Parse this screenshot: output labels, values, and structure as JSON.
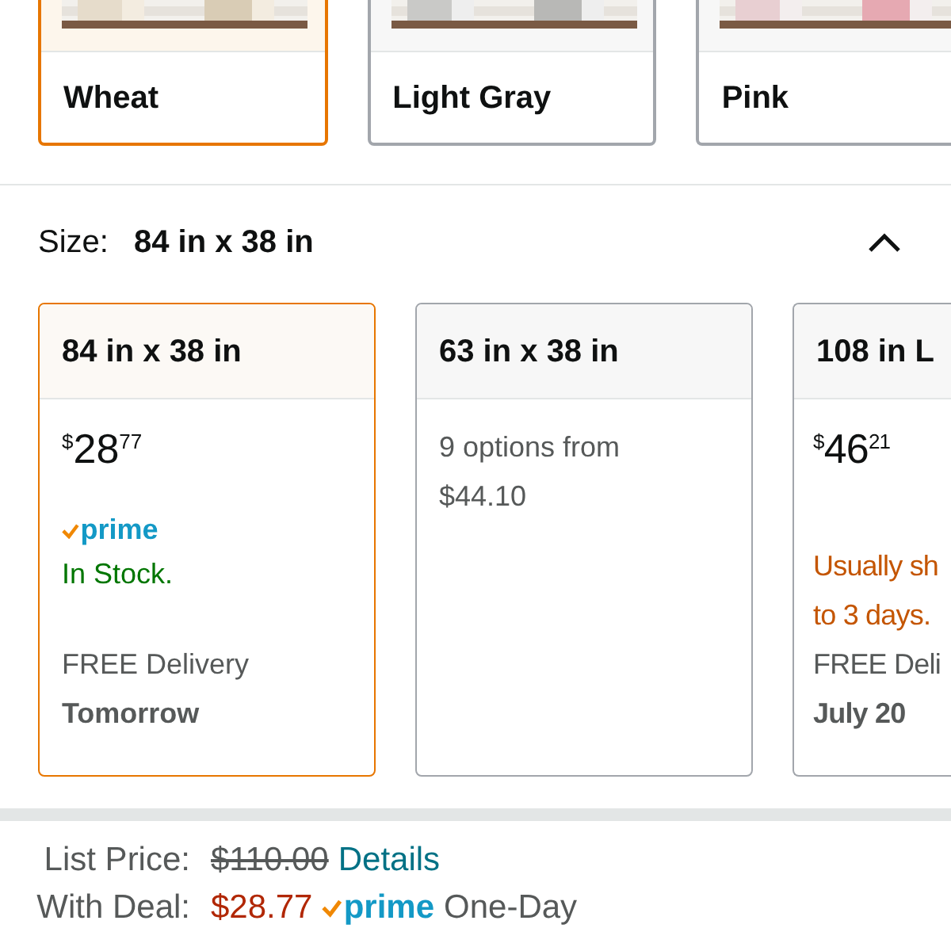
{
  "colors": [
    {
      "name": "Wheat",
      "selected": true,
      "kind": "picture"
    },
    {
      "name": "Light Gray",
      "selected": false,
      "kind": "picture"
    },
    {
      "name": "Pink",
      "selected": false,
      "kind": "picture"
    }
  ],
  "size": {
    "label": "Size:",
    "value": "84 in x 38 in",
    "expanded": true
  },
  "size_options": [
    {
      "kind": "offer",
      "title": "84 in x 38 in",
      "selected": true,
      "currency": "$",
      "dollars": "28",
      "cents": "77",
      "prime_badge": "prime",
      "availability": {
        "lines": [
          "In Stock."
        ],
        "color": "#007600"
      },
      "delivery_label": "FREE Delivery",
      "delivery_date": "Tomorrow"
    },
    {
      "kind": "options",
      "title": "63 in x 38 in",
      "selected": false,
      "options_text": "9 options from $44.10"
    },
    {
      "kind": "offer",
      "title": "108 in L",
      "selected": false,
      "currency": "$",
      "dollars": "46",
      "cents": "21",
      "availability": {
        "lines": [
          "Usually sh",
          "to 3 days."
        ],
        "color": "#c45500"
      },
      "delivery_label": "FREE Deli",
      "delivery_date": "July 20"
    }
  ],
  "list_price": {
    "label": "List Price:",
    "value": "$110.00",
    "link": "Details"
  },
  "deal": {
    "label": "With Deal:",
    "price": "$28.77",
    "prime_badge": "prime",
    "shipping": "One-Day"
  }
}
